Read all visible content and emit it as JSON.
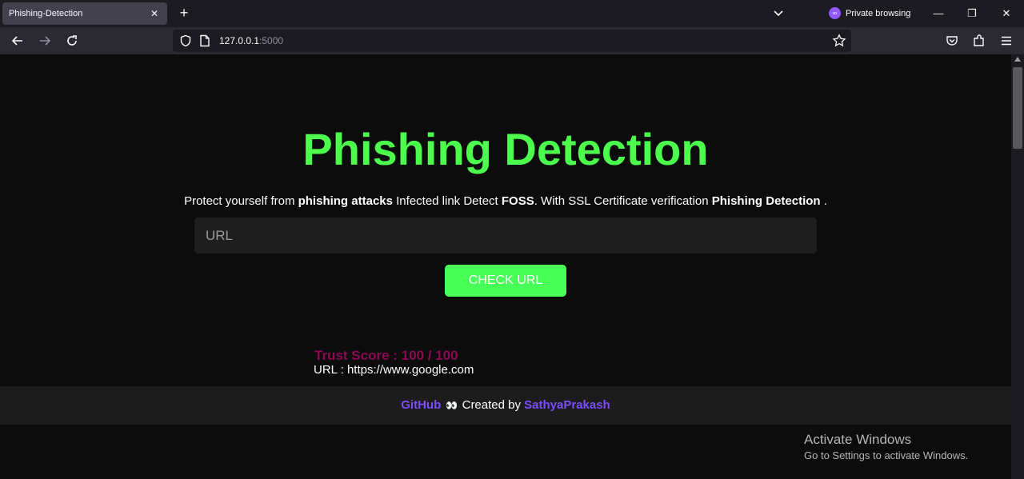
{
  "browser": {
    "tab_title": "Phishing-Detection",
    "tab_close": "✕",
    "new_tab": "+",
    "private_label": "Private browsing",
    "url_host": "127.0.0.1",
    "url_port": ":5000",
    "win_minimize": "—",
    "win_restore": "❐",
    "win_close": "✕"
  },
  "page": {
    "title": "Phishing Detection",
    "tagline": {
      "t1": "Protect yourself from ",
      "b1": "phishing attacks",
      "t2": " Infected link Detect ",
      "b2": "FOSS",
      "t3": ". With SSL Certificate verification ",
      "b3": "Phishing Detection",
      "t4": " ."
    },
    "url_placeholder": "URL",
    "check_button": "CHECK URL",
    "trust_score": "Trust Score : 100 / 100",
    "checked_url": "URL : https://www.google.com"
  },
  "footer": {
    "github": "GitHub",
    "eyes": "👀",
    "created_by": " Created by ",
    "author": "SathyaPrakash"
  },
  "watermark": {
    "title": "Activate Windows",
    "subtitle": "Go to Settings to activate Windows."
  },
  "colors": {
    "accent_green": "#4dff4d",
    "trust_color": "#8b0a52",
    "link_purple": "#7c4dff"
  }
}
